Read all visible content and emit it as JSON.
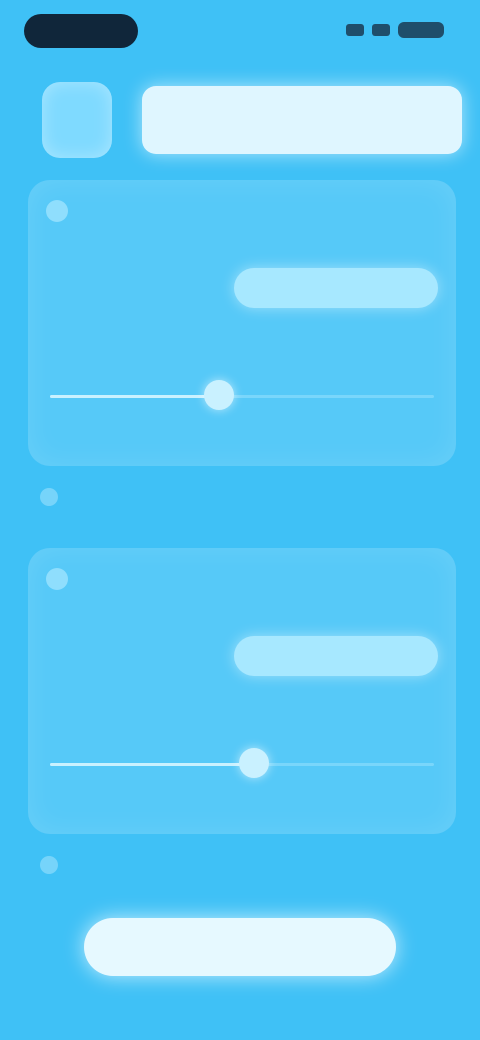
{
  "header": {
    "title": ""
  },
  "card1": {
    "label": "",
    "value": "",
    "button_label": "",
    "slider_label": "",
    "slider_value": 0.44
  },
  "card2": {
    "label": "",
    "value": "",
    "button_label": "",
    "slider_label": "",
    "slider_value": 0.53
  },
  "note1": {
    "text": ""
  },
  "note2": {
    "text": ""
  },
  "cta": {
    "label": ""
  },
  "colors": {
    "background": "#3fc1f6",
    "card": "#56c9f8",
    "accent_light": "#e6f9ff"
  }
}
